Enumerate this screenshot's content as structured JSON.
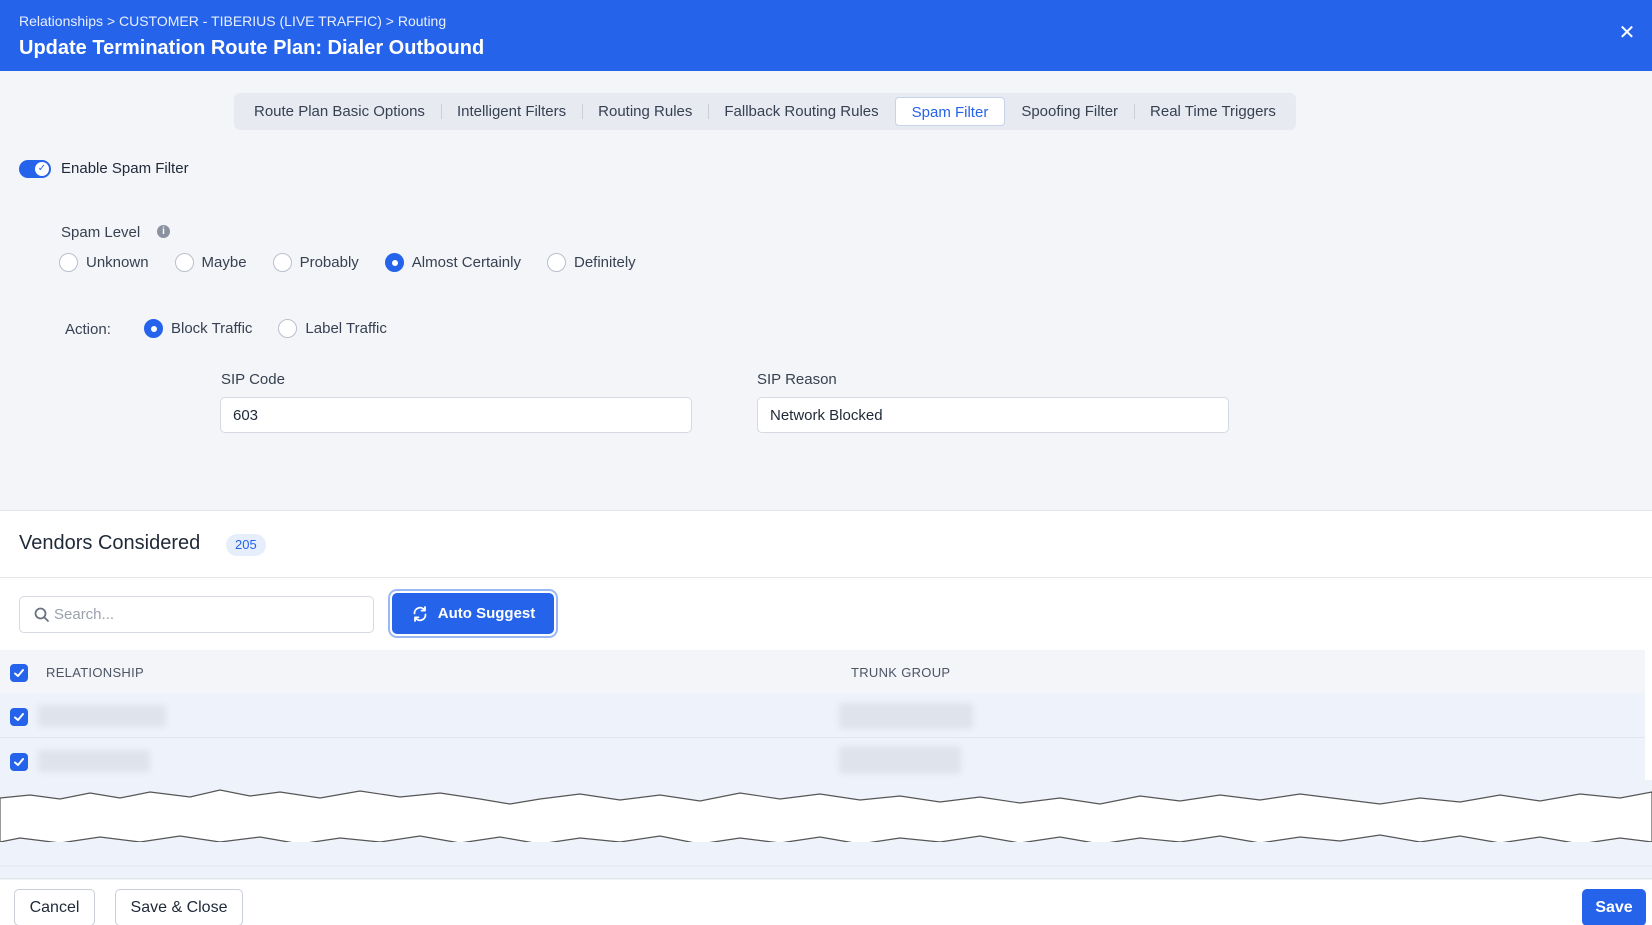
{
  "header": {
    "breadcrumb": "Relationships > CUSTOMER - TIBERIUS (LIVE TRAFFIC) > Routing",
    "title": "Update Termination Route Plan: Dialer Outbound",
    "close_icon": "close-icon"
  },
  "tabs": [
    {
      "label": "Route Plan Basic Options",
      "active": false
    },
    {
      "label": "Intelligent Filters",
      "active": false
    },
    {
      "label": "Routing Rules",
      "active": false
    },
    {
      "label": "Fallback Routing Rules",
      "active": false
    },
    {
      "label": "Spam Filter",
      "active": true
    },
    {
      "label": "Spoofing Filter",
      "active": false
    },
    {
      "label": "Real Time Triggers",
      "active": false
    }
  ],
  "spam_filter": {
    "enable_label": "Enable Spam Filter",
    "enabled": true,
    "spam_level_label": "Spam Level",
    "spam_levels": [
      "Unknown",
      "Maybe",
      "Probably",
      "Almost Certainly",
      "Definitely"
    ],
    "spam_level_selected": "Almost Certainly",
    "action_label": "Action:",
    "actions": [
      "Block Traffic",
      "Label Traffic"
    ],
    "action_selected": "Block Traffic",
    "sip_code_label": "SIP Code",
    "sip_code_value": "603",
    "sip_reason_label": "SIP Reason",
    "sip_reason_value": "Network Blocked"
  },
  "vendors": {
    "title": "Vendors Considered",
    "count": "205",
    "search_placeholder": "Search...",
    "auto_suggest_label": "Auto Suggest",
    "columns": [
      "RELATIONSHIP",
      "TRUNK GROUP"
    ]
  },
  "footer": {
    "cancel_label": "Cancel",
    "save_close_label": "Save & Close",
    "save_label": "Save"
  },
  "colors": {
    "accent": "#2563eb",
    "header_bg": "#2563eb",
    "panel_bg": "#f3f5f9"
  }
}
